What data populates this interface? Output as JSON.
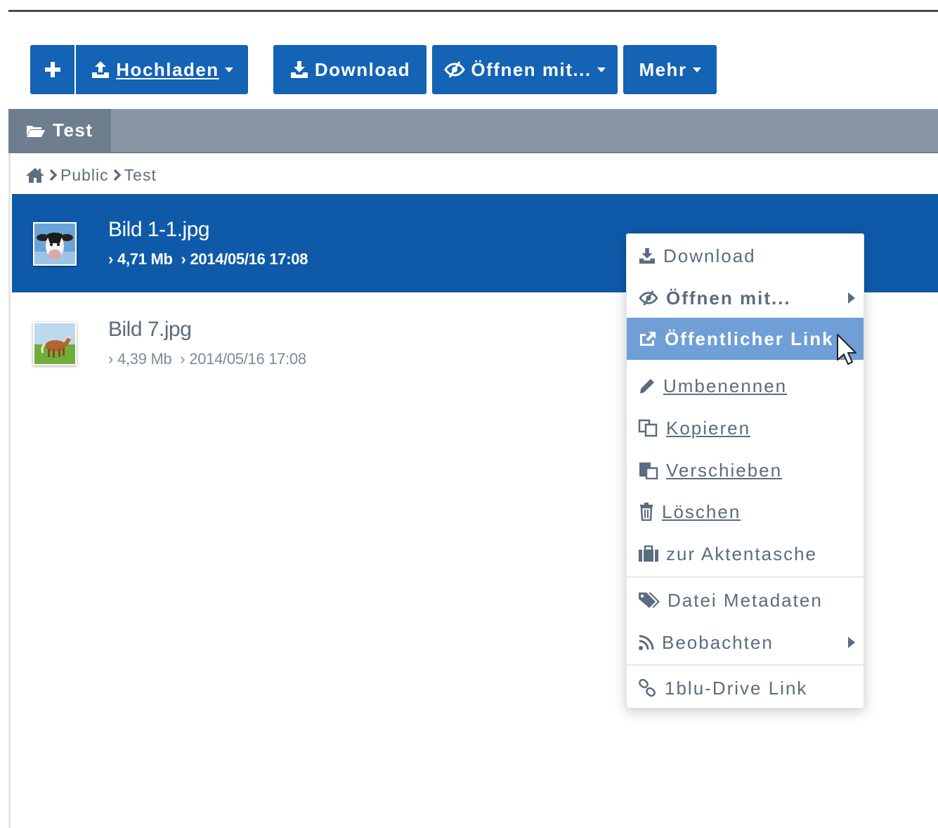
{
  "toolbar": {
    "add_icon": "plus-icon",
    "upload_label": "Hochladen",
    "download_label": "Download",
    "open_with_label": "Öffnen mit...",
    "more_label": "Mehr"
  },
  "tab": {
    "label": "Test",
    "icon": "folder-open-icon"
  },
  "breadcrumb": {
    "items": [
      "Public",
      "Test"
    ]
  },
  "files": [
    {
      "name": "Bild 1-1.jpg",
      "size": "4,71 Mb",
      "date": "2014/05/16 17:08",
      "selected": true
    },
    {
      "name": "Bild 7.jpg",
      "size": "4,39 Mb",
      "date": "2014/05/16 17:08",
      "selected": false
    }
  ],
  "context_menu": {
    "items": [
      {
        "label": "Download",
        "icon": "download-icon"
      },
      {
        "label": "Öffnen mit...",
        "icon": "eye-slash-icon",
        "submenu": true
      },
      {
        "label": "Öffentlicher Link",
        "icon": "share-icon",
        "highlighted": true
      },
      {
        "label": "Umbenennen",
        "icon": "pencil-icon"
      },
      {
        "label": "Kopieren",
        "icon": "copy-icon"
      },
      {
        "label": "Verschieben",
        "icon": "paste-icon"
      },
      {
        "label": "Löschen",
        "icon": "trash-icon"
      },
      {
        "label": "zur Aktentasche",
        "icon": "briefcase-icon"
      },
      {
        "label": "Datei Metadaten",
        "icon": "tags-icon"
      },
      {
        "label": "Beobachten",
        "icon": "rss-icon",
        "submenu": true
      },
      {
        "label": "1blu-Drive Link",
        "icon": "link-icon"
      }
    ]
  },
  "colors": {
    "primary": "#1463b5",
    "selected_row": "#0e5aa9",
    "menu_highlight": "#6f9fd6",
    "tabbar": "#8a96a3",
    "text_muted": "#5a6d7e"
  }
}
